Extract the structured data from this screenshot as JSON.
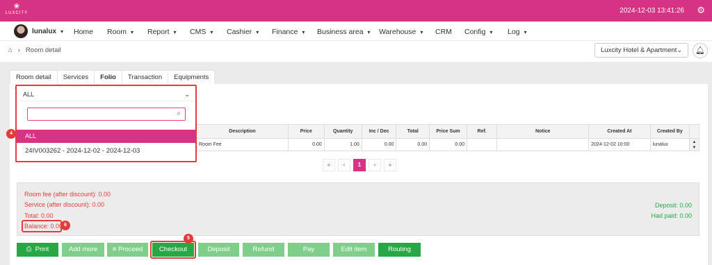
{
  "topbar": {
    "logo_text": "LUXCITY",
    "datetime": "2024-12-03 13:41:26"
  },
  "nav": {
    "user": "lunalux",
    "items": [
      "Home",
      "Room",
      "Report",
      "CMS",
      "Cashier",
      "Finance",
      "Business area",
      "Warehouse",
      "CRM",
      "Config",
      "Log"
    ]
  },
  "breadcrumb": {
    "current": "Room detail"
  },
  "hotel_select": {
    "value": "Luxcity Hotel & Apartment"
  },
  "tabs": [
    "Room detail",
    "Services",
    "Folio",
    "Transaction",
    "Equipments"
  ],
  "folio_filter": {
    "selected": "ALL",
    "search_placeholder": "",
    "options": [
      "ALL",
      "24IV003262 - 2024-12-02 - 2024-12-03"
    ]
  },
  "table": {
    "headers": [
      "Description",
      "Price",
      "Quantity",
      "Inc / Dec",
      "Total",
      "Price Sum",
      "Ref.",
      "Notice",
      "Created At",
      "Created By"
    ],
    "row": {
      "description": "Room Fee",
      "price": "0.00",
      "quantity": "1.00",
      "inc_dec": "0.00",
      "total": "0.00",
      "price_sum": "0.00",
      "ref": "",
      "notice": "",
      "created_at": "2024-12-02 10:00",
      "created_by": "lunalux"
    }
  },
  "pagination": {
    "first": "«",
    "prev": "‹",
    "current": "1",
    "next": "›",
    "last": "»"
  },
  "summary": {
    "room_fee": "Room fee (after discount): 0.00",
    "service": "Service (after discount): 0.00",
    "total": "Total: 0.00",
    "balance": "Balance: 0.00",
    "deposit": "Deposit: 0.00",
    "had_paid": "Had paid: 0.00"
  },
  "buttons": {
    "print": "Print",
    "add_more": "Add more",
    "proceed": "Proceed",
    "checkout": "Checkout",
    "deposit": "Deposit",
    "refund": "Refund",
    "pay": "Pay",
    "edit_item": "Edit item",
    "routing": "Routing"
  },
  "annotations": {
    "dropdown": "4",
    "checkout": "5",
    "balance": "6"
  },
  "colors": {
    "brand": "#d63384",
    "accent_green": "#28a745",
    "light_green": "#7fcf8b",
    "highlight_red": "#e33b3b"
  }
}
